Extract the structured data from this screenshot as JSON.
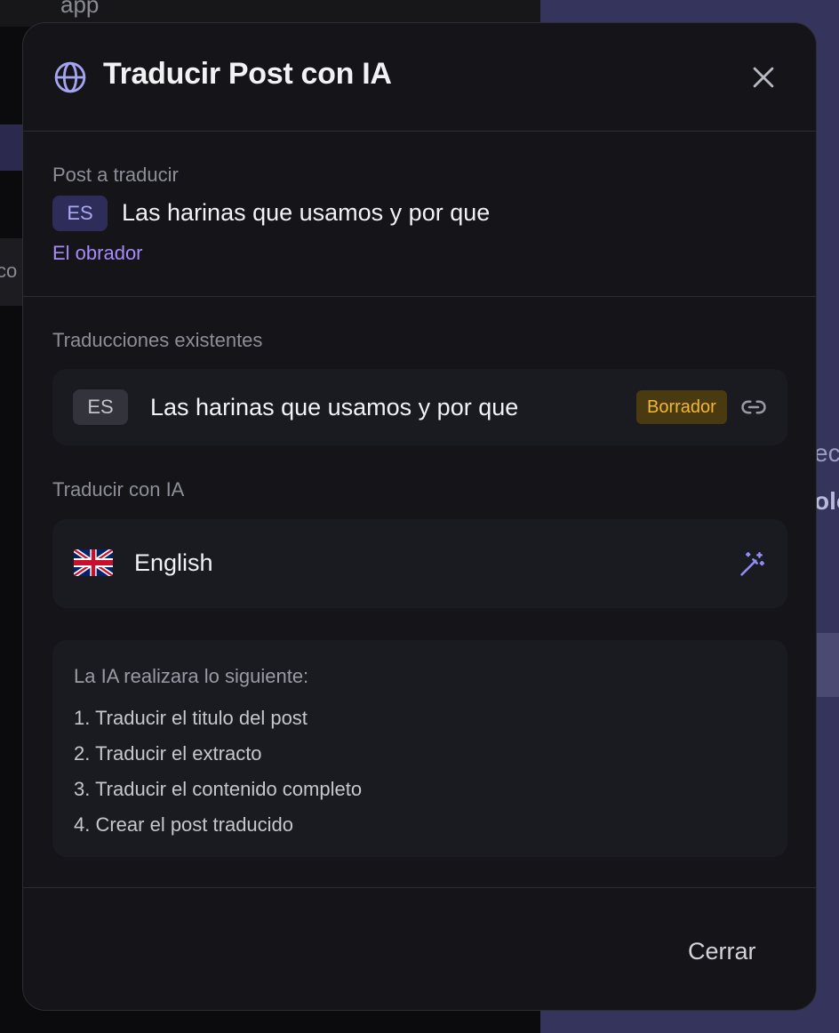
{
  "background": {
    "folder_label": "app",
    "left_fragment": "co",
    "right_fragment_1": "ec",
    "right_fragment_2": "olo"
  },
  "modal": {
    "title": "Traducir Post con IA",
    "icon": "globe-icon",
    "close_icon": "close-icon"
  },
  "source": {
    "label": "Post a traducir",
    "lang": "ES",
    "post_title": "Las harinas que usamos y por que",
    "category": "El obrador"
  },
  "existing": {
    "label": "Traducciones existentes",
    "items": [
      {
        "lang": "ES",
        "title": "Las harinas que usamos y por que",
        "status": "Borrador",
        "icon": "link-icon"
      }
    ]
  },
  "translate": {
    "label": "Traducir con IA",
    "languages": [
      {
        "flag": "uk-flag-icon",
        "name": "English",
        "action_icon": "magic-wand-icon"
      }
    ]
  },
  "info": {
    "title": "La IA realizara lo siguiente:",
    "steps": [
      "1. Traducir el titulo del post",
      "2. Traducir el extracto",
      "3. Traducir el contenido completo",
      "4. Crear el post traducido"
    ]
  },
  "footer": {
    "close_label": "Cerrar"
  },
  "colors": {
    "accent": "#a78bfa",
    "badge_bg": "#2e2d5a",
    "draft_badge": "#f0b73a",
    "modal_bg": "#141419"
  }
}
